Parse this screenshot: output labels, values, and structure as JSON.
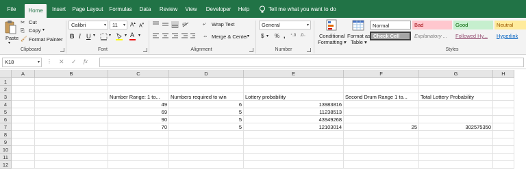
{
  "tabs": [
    "File",
    "Home",
    "Insert",
    "Page Layout",
    "Formulas",
    "Data",
    "Review",
    "View",
    "Developer",
    "Help"
  ],
  "tell_me": "Tell me what you want to do",
  "clipboard": {
    "paste": "Paste",
    "cut": "Cut",
    "copy": "Copy",
    "format_painter": "Format Painter",
    "label": "Clipboard"
  },
  "font": {
    "name": "Calibri",
    "size": "11",
    "label": "Font"
  },
  "alignment": {
    "wrap_text": "Wrap Text",
    "merge_center": "Merge & Center",
    "label": "Alignment"
  },
  "number": {
    "format": "General",
    "dollar": "$",
    "percent": "%",
    "comma": ",",
    "label": "Number"
  },
  "styles": {
    "conditional_formatting": [
      "Conditional",
      "Formatting"
    ],
    "format_as_table": [
      "Format as",
      "Table"
    ],
    "cells": [
      "Normal",
      "Bad",
      "Good",
      "Neutral",
      "Check Cell",
      "Explanatory ...",
      "Followed Hy...",
      "Hyperlink"
    ],
    "label": "Styles"
  },
  "namebox": "K18",
  "columns": [
    "A",
    "B",
    "C",
    "D",
    "E",
    "F",
    "G",
    "H"
  ],
  "rows": [
    "1",
    "2",
    "3",
    "4",
    "5",
    "6",
    "7",
    "8",
    "9",
    "10",
    "11",
    "12"
  ],
  "cells": {
    "C3": "Number Range: 1 to...",
    "D3": "Numbers required to win",
    "E3": "Lottery probability",
    "F3": "Second Drum Range 1 to...",
    "G3": "Total Lottery Probability",
    "C4": "49",
    "D4": "6",
    "E4": "13983816",
    "C5": "69",
    "D5": "5",
    "E5": "11238513",
    "C6": "90",
    "D6": "5",
    "E6": "43949268",
    "C7": "70",
    "D7": "5",
    "E7": "12103014",
    "F7": "25",
    "G7": "302575350"
  },
  "colors": {
    "ribbon_green": "#217346",
    "bad_bg": "#ffc7ce",
    "good_bg": "#c6efce",
    "neutral_bg": "#ffeb9c",
    "check_cell_bg": "#a5a5a5"
  }
}
